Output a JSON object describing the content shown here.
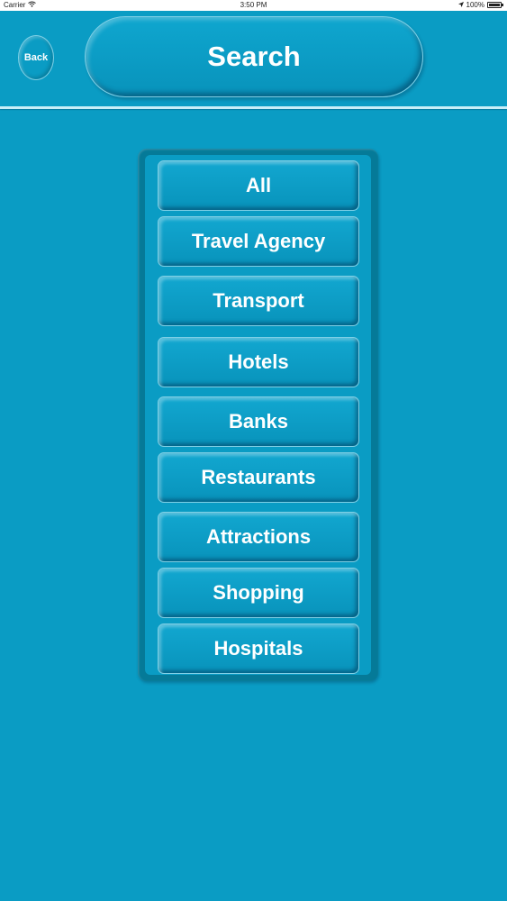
{
  "status_bar": {
    "carrier": "Carrier",
    "wifi_icon": "wifi-icon",
    "time": "3:50 PM",
    "location_icon": "location-arrow-icon",
    "battery_percent": "100%",
    "battery_level": 1.0
  },
  "header": {
    "back_label": "Back",
    "title": "Search"
  },
  "categories": [
    {
      "label": "All"
    },
    {
      "label": "Travel Agency"
    },
    {
      "label": "Transport"
    },
    {
      "label": "Hotels"
    },
    {
      "label": "Banks"
    },
    {
      "label": "Restaurants"
    },
    {
      "label": "Attractions"
    },
    {
      "label": "Shopping"
    },
    {
      "label": "Hospitals"
    }
  ],
  "colors": {
    "background": "#0a9cc4",
    "panel_border": "#057a98",
    "text": "#ffffff"
  }
}
